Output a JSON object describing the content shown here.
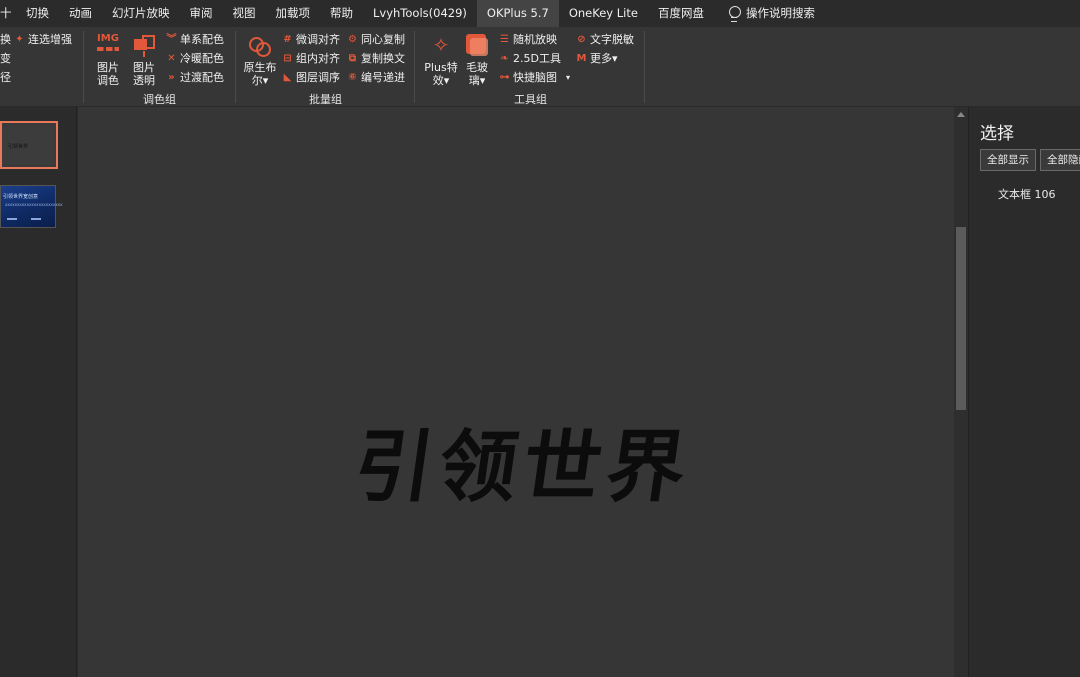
{
  "menu": {
    "items": [
      "切换",
      "动画",
      "幻灯片放映",
      "审阅",
      "视图",
      "加载项",
      "帮助",
      "LvyhTools(0429)",
      "OKPlus 5.7",
      "OneKey Lite",
      "百度网盘"
    ],
    "active": "OKPlus 5.7",
    "search_label": "操作说明搜索",
    "first_glyph": "十"
  },
  "ribbon": {
    "partial_left": [
      "换",
      "变",
      "径"
    ],
    "enhance": "连选增强",
    "color_group": {
      "label": "调色组",
      "img_icon_text": "IMG",
      "img_adjust": [
        "图片",
        "调色"
      ],
      "img_transparent": [
        "图片",
        "透明"
      ],
      "single_color": "单系配色",
      "cool_warm": "冷暖配色",
      "transition": "过渡配色"
    },
    "batch_group": {
      "label": "批量组",
      "boolean": [
        "原生布",
        "尔▾"
      ],
      "fine_align": "微调对齐",
      "group_align": "组内对齐",
      "layer_order": "图层调序",
      "concentric_copy": "同心复制",
      "copy_swap": "复制换文",
      "number_increment": "编号递进"
    },
    "tool_group": {
      "label": "工具组",
      "plus_effect": [
        "Plus特",
        "效▾"
      ],
      "frosted_glass": [
        "毛玻",
        "璃▾"
      ],
      "random_place": "随机放映",
      "tool_25d": "2.5D工具",
      "quick_brain": "快捷脑图",
      "text_desensitize": "文字脱敏",
      "more": "更多▾"
    }
  },
  "slides": {
    "thumb1_text": "引领世界",
    "thumb2_title": "引领世界宽创意",
    "thumb2_sub": "XXXXXXXXXXXXXXXXXXXXXXXX"
  },
  "canvas": {
    "slide_text": "引领世界"
  },
  "selection_pane": {
    "title": "选择",
    "show_all": "全部显示",
    "hide_all": "全部隐藏",
    "item": "文本框 106"
  },
  "colors": {
    "accent": "#e2583a",
    "selected_thumb_border": "#e8795a"
  }
}
